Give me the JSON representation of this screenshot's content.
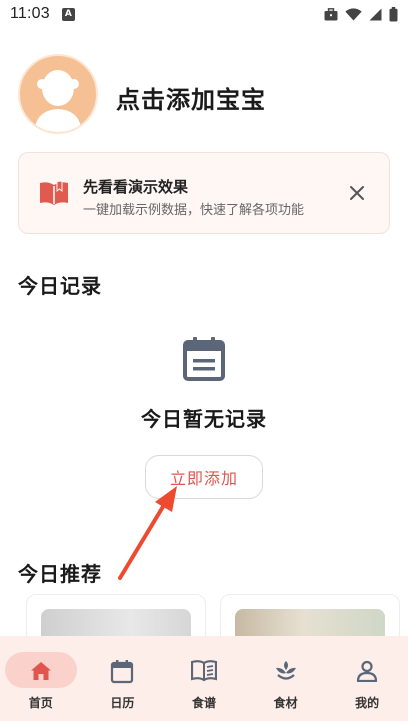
{
  "status_bar": {
    "time": "11:03",
    "a_badge": "A"
  },
  "profile": {
    "name": "点击添加宝宝"
  },
  "demo_card": {
    "title": "先看看演示效果",
    "subtitle": "一键加载示例数据，快速了解各项功能",
    "icon": "book-icon",
    "close_icon": "close-icon"
  },
  "today": {
    "title": "今日记录",
    "empty_text": "今日暂无记录",
    "add_label": "立即添加"
  },
  "recommend": {
    "title": "今日推荐"
  },
  "nav": {
    "items": [
      {
        "label": "首页",
        "icon": "home-icon",
        "active": true
      },
      {
        "label": "日历",
        "icon": "calendar-icon"
      },
      {
        "label": "食谱",
        "icon": "recipe-book-icon"
      },
      {
        "label": "食材",
        "icon": "sprout-icon"
      },
      {
        "label": "我的",
        "icon": "person-icon"
      }
    ]
  },
  "colors": {
    "accent": "#e0564f",
    "nav_bg": "#fdeee9",
    "nav_pill": "#fbd2cb",
    "avatar_bg": "#f6c095"
  }
}
